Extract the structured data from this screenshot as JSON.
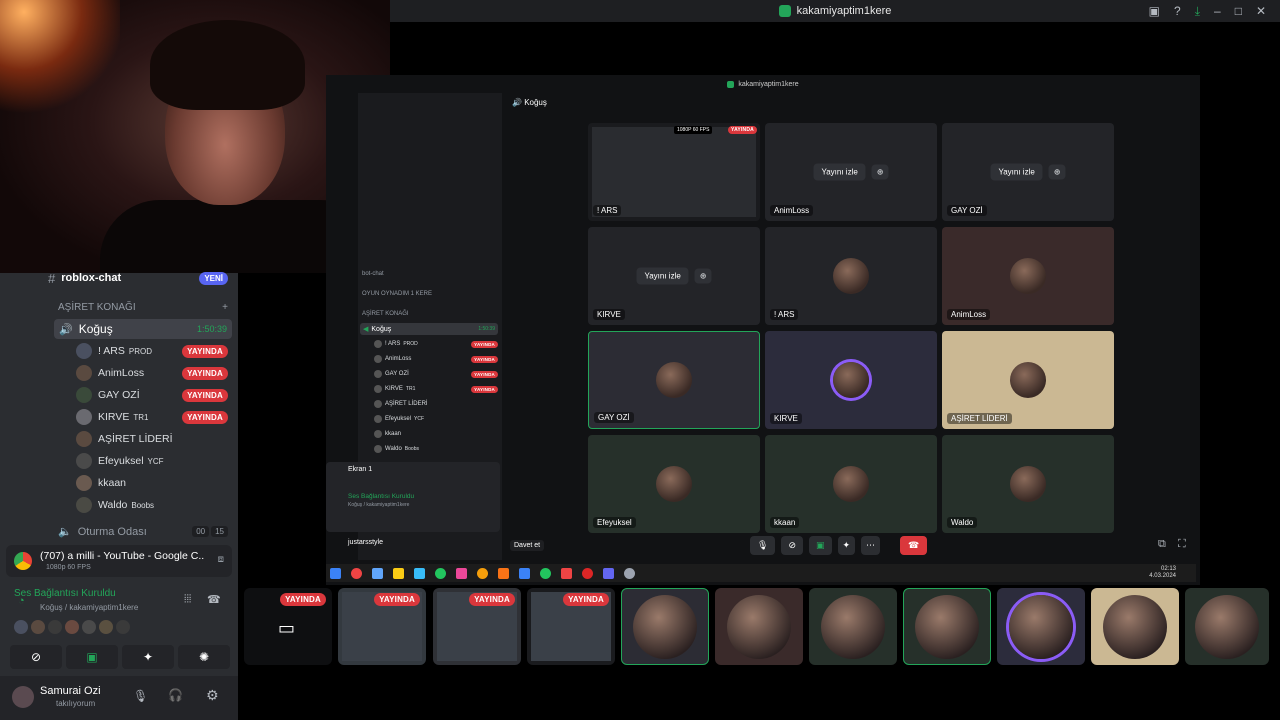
{
  "window_title": "kakamiyaptim1kere",
  "inner_window_title": "kakamiyaptim1kere",
  "inner_channel_name": "Koğuş",
  "inner_server_name": "miyaptim1kere",
  "sidebar": {
    "top_channel": {
      "name": "roblox-chat",
      "badge": "YENİ"
    },
    "category": "AŞİRET KONAĞI",
    "voice_channel": {
      "name": "Koğuş",
      "timer": "1:50:39"
    },
    "members": [
      {
        "name": "! ARS",
        "tag": "PROD",
        "live": "YAYINDA"
      },
      {
        "name": "AnimLoss",
        "tag": "",
        "live": "YAYINDA"
      },
      {
        "name": "GAY OZİ",
        "tag": "",
        "live": "YAYINDA"
      },
      {
        "name": "KIRVE",
        "tag": "TR1",
        "live": "YAYINDA"
      },
      {
        "name": "AŞİRET LİDERİ",
        "tag": "",
        "live": ""
      },
      {
        "name": "Efeyuksel",
        "tag": "YCF",
        "live": ""
      },
      {
        "name": "kkaan",
        "tag": "",
        "live": ""
      },
      {
        "name": "Waldo",
        "tag": "Boobs",
        "live": ""
      }
    ],
    "other_voice": {
      "name": "Oturma Odası",
      "count1": "00",
      "count2": "15"
    },
    "stream_app": {
      "title": "(707) a milli - YouTube - Google C...",
      "quality": "1080p 60 FPS"
    },
    "connection": {
      "status": "Ses Bağlantısı Kuruldu",
      "location": "Koğuş / kakamiyaptim1kere"
    },
    "user": {
      "name": "Samurai Ozi",
      "status": "takılıyorum"
    }
  },
  "inner_sidebar": {
    "channels": [
      "bot-chat",
      "OYUN OYNADIM 1 KERE",
      "AŞİRET KONAĞI"
    ],
    "voice_channel": {
      "name": "Koğuş",
      "timer": "1:50:39"
    },
    "members": [
      {
        "name": "! ARS",
        "tag": "PROD",
        "live": "YAYINDA"
      },
      {
        "name": "AnimLoss",
        "tag": "",
        "live": "YAYINDA"
      },
      {
        "name": "GAY OZİ",
        "tag": "",
        "live": "YAYINDA"
      },
      {
        "name": "KIRVE",
        "tag": "TR1",
        "live": "YAYINDA"
      },
      {
        "name": "AŞİRET LİDERİ",
        "tag": "",
        "live": ""
      },
      {
        "name": "Efeyuksel",
        "tag": "YCF",
        "live": ""
      },
      {
        "name": "kkaan",
        "tag": "",
        "live": ""
      },
      {
        "name": "Waldo",
        "tag": "Boobs",
        "live": ""
      }
    ],
    "screen_share": {
      "title": "Ekran 1"
    },
    "connection": {
      "status": "Ses Bağlantısı Kuruldu",
      "location": "Koğuş / kakamiyaptim1kere"
    },
    "user": {
      "name": "justarsstyle"
    }
  },
  "grid": {
    "watch_label": "Yayını izle",
    "stream_quality": "1080P 60 FPS",
    "live_label": "YAYINDA",
    "tiles": [
      "! ARS",
      "AnimLoss",
      "GAY OZİ",
      "KIRVE",
      "! ARS",
      "AnimLoss",
      "GAY OZİ",
      "KIRVE",
      "AŞİRET LİDERİ",
      "Efeyuksel",
      "kkaan",
      "Waldo"
    ]
  },
  "invite_label": "Davet et",
  "taskbar": {
    "time": "02:13",
    "date": "4.03.2024"
  },
  "thumb_live_label": "YAYINDA",
  "colors": {
    "live": "#da373c",
    "accent": "#23a559",
    "bg": "#2b2d31"
  }
}
